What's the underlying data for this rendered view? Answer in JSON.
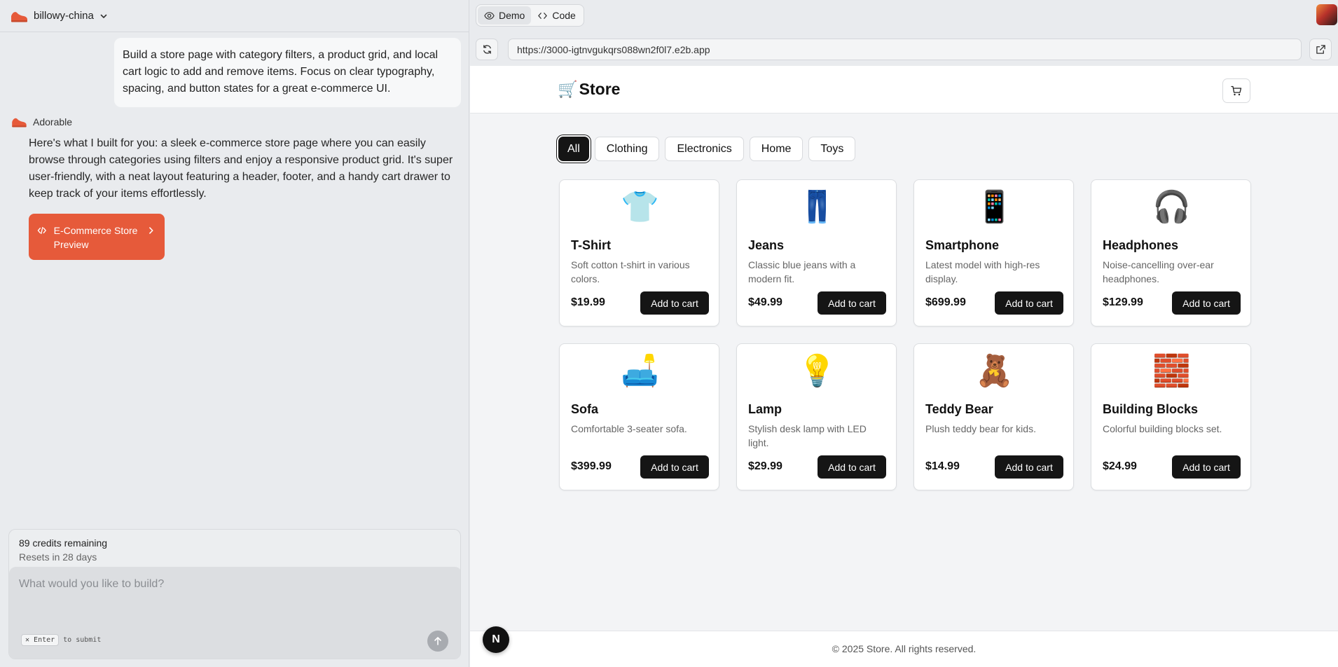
{
  "app": {
    "project_name": "billowy-china"
  },
  "chat": {
    "user_message": "Build a store page with category filters, a product grid, and local cart logic to add and remove items. Focus on clear typography, spacing, and button states for a great e-commerce UI.",
    "assistant_name": "Adorable",
    "assistant_message": "Here's what I built for you: a sleek e-commerce store page where you can easily browse through categories using filters and enjoy a responsive product grid. It's super user-friendly, with a neat layout featuring a header, footer, and a handy cart drawer to keep track of your items effortlessly.",
    "preview_button_label": "E-Commerce Store Preview"
  },
  "credits": {
    "remaining": "89 credits remaining",
    "resets": "Resets in 28 days"
  },
  "composer": {
    "placeholder": "What would you like to build?",
    "kbd_label": "Enter",
    "kbd_hint": "to submit"
  },
  "preview_toolbar": {
    "demo_label": "Demo",
    "code_label": "Code",
    "active_tab": "Demo",
    "url": "https://3000-igtnvgukqrs088wn2f0l7.e2b.app"
  },
  "store": {
    "title": "Store",
    "title_emoji": "🛒",
    "filters": [
      {
        "label": "All",
        "active": true
      },
      {
        "label": "Clothing",
        "active": false
      },
      {
        "label": "Electronics",
        "active": false
      },
      {
        "label": "Home",
        "active": false
      },
      {
        "label": "Toys",
        "active": false
      }
    ],
    "add_to_cart_label": "Add to cart",
    "products": [
      {
        "emoji": "👕",
        "name": "T-Shirt",
        "description": "Soft cotton t-shirt in various colors.",
        "price": "$19.99"
      },
      {
        "emoji": "👖",
        "name": "Jeans",
        "description": "Classic blue jeans with a modern fit.",
        "price": "$49.99"
      },
      {
        "emoji": "📱",
        "name": "Smartphone",
        "description": "Latest model with high-res display.",
        "price": "$699.99"
      },
      {
        "emoji": "🎧",
        "name": "Headphones",
        "description": "Noise-cancelling over-ear headphones.",
        "price": "$129.99"
      },
      {
        "emoji": "🛋️",
        "name": "Sofa",
        "description": "Comfortable 3-seater sofa.",
        "price": "$399.99"
      },
      {
        "emoji": "💡",
        "name": "Lamp",
        "description": "Stylish desk lamp with LED light.",
        "price": "$29.99"
      },
      {
        "emoji": "🧸",
        "name": "Teddy Bear",
        "description": "Plush teddy bear for kids.",
        "price": "$14.99"
      },
      {
        "emoji": "🧱",
        "name": "Building Blocks",
        "description": "Colorful building blocks set.",
        "price": "$24.99"
      }
    ],
    "footer": "© 2025 Store. All rights reserved."
  },
  "nextjs_badge": "N",
  "colors": {
    "accent": "#e65a3a",
    "button_dark": "#151515"
  }
}
